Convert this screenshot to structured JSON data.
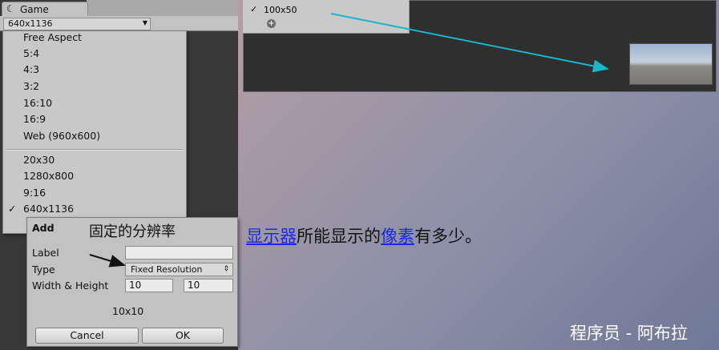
{
  "game_window": {
    "tab_label": "Game",
    "aspect_value": "640x1136"
  },
  "aspect_menu": {
    "group1": [
      "Free Aspect",
      "5:4",
      "4:3",
      "3:2",
      "16:10",
      "16:9",
      "Web (960x600)"
    ],
    "group2": [
      "20x30",
      "1280x800",
      "9:16",
      "640x1136"
    ],
    "selected": "640x1136"
  },
  "add_dialog": {
    "title": "Add",
    "label_label": "Label",
    "label_value": "",
    "type_label": "Type",
    "type_value": "Fixed Resolution",
    "width_height_label": "Width & Height",
    "width": "10",
    "height": "10",
    "preview": "10x10",
    "cancel": "Cancel",
    "ok": "OK"
  },
  "annotation": {
    "fixed_resolution_note": "固定的分辨率"
  },
  "resolution_popup": {
    "check": "✓",
    "entry": "100x50"
  },
  "caption": {
    "link1": "显示器",
    "text1": "所能显示的",
    "link2": "像素",
    "text2": "有多少。"
  },
  "watermark": "程序员 - 阿布拉",
  "colors": {
    "arrow": "#1ab7c9",
    "link": "#1a2bdd",
    "unity_dark": "#383838"
  }
}
